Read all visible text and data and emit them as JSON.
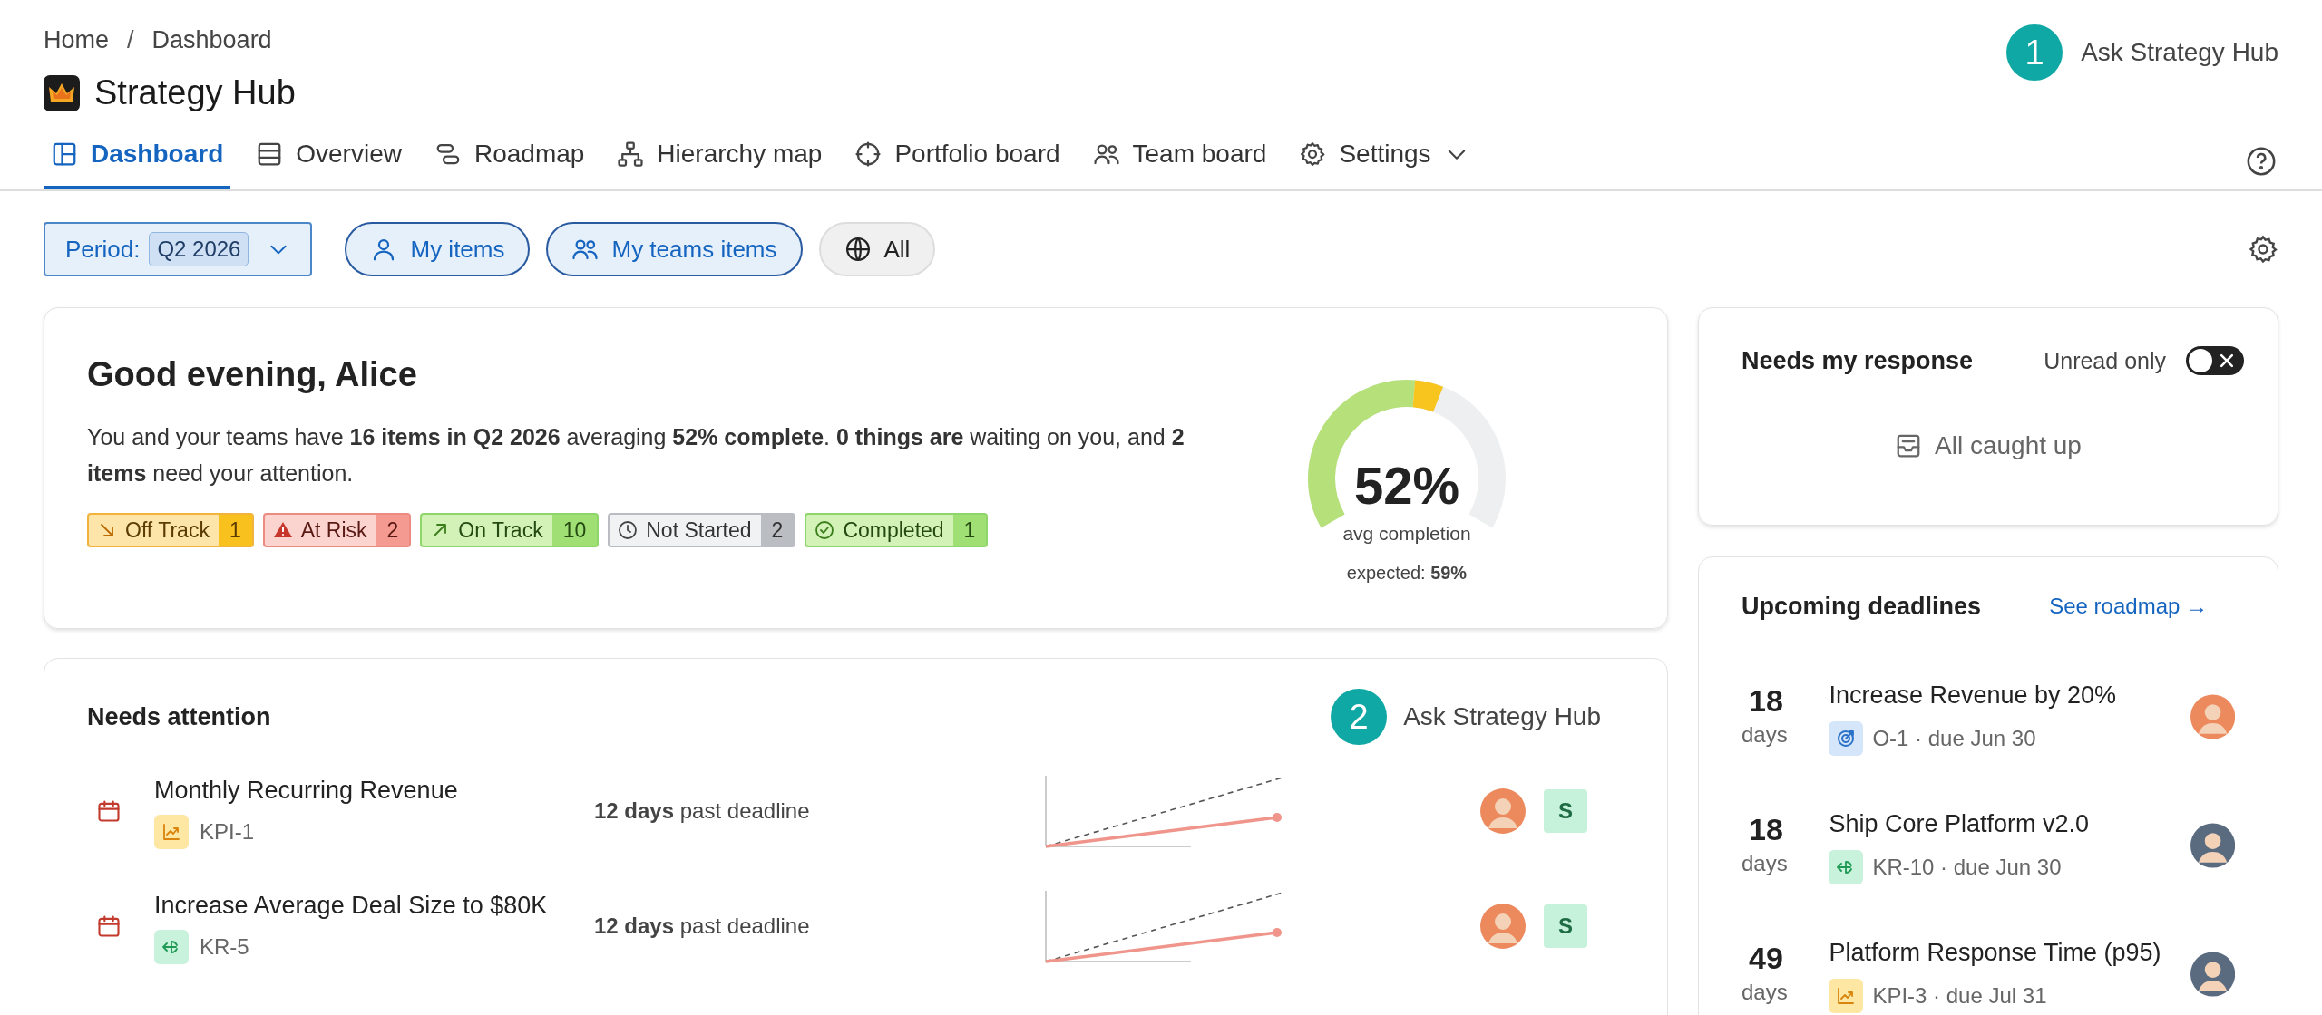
{
  "breadcrumb": [
    {
      "label": "Home"
    },
    {
      "label": "Dashboard"
    }
  ],
  "breadcrumb_separator": "/",
  "app": {
    "title": "Strategy Hub"
  },
  "assistant_button": {
    "badge": "1",
    "label": "Ask Strategy Hub"
  },
  "tabs": [
    {
      "kind": "dashboard",
      "label": "Dashboard",
      "selected": true,
      "dropdown": false
    },
    {
      "kind": "overview",
      "label": "Overview",
      "selected": false,
      "dropdown": false
    },
    {
      "kind": "roadmap",
      "label": "Roadmap",
      "selected": false,
      "dropdown": false
    },
    {
      "kind": "hierarchy",
      "label": "Hierarchy map",
      "selected": false,
      "dropdown": false
    },
    {
      "kind": "portfolio",
      "label": "Portfolio board",
      "selected": false,
      "dropdown": false
    },
    {
      "kind": "team",
      "label": "Team board",
      "selected": false,
      "dropdown": false
    },
    {
      "kind": "settings",
      "label": "Settings",
      "selected": false,
      "dropdown": true
    }
  ],
  "filters": {
    "period": {
      "label": "Period:",
      "value": "Q2 2026"
    },
    "scopes": [
      {
        "kind": "person",
        "label": "My items",
        "selected": true
      },
      {
        "kind": "team",
        "label": "My teams items",
        "selected": true
      },
      {
        "kind": "globe",
        "label": "All",
        "selected": false
      }
    ]
  },
  "summary_card": {
    "title": "Good evening, Alice",
    "text": "You and your teams have **16 items in Q2 2026** averaging **52% complete**. **0 things are** waiting on you, and **2 items** need your attention.",
    "status_chips": [
      {
        "kind": "off_track",
        "label": "Off Track",
        "count": "1"
      },
      {
        "kind": "at_risk",
        "label": "At Risk",
        "count": "2"
      },
      {
        "kind": "on_track",
        "label": "On Track",
        "count": "10"
      },
      {
        "kind": "not_started",
        "label": "Not Started",
        "count": "2"
      },
      {
        "kind": "completed",
        "label": "Completed",
        "count": "1"
      }
    ],
    "gauge": {
      "value": "52%",
      "caption": "avg completion",
      "expected": "expected: **59%**",
      "segments": [
        {
          "kind": "actual",
          "level": 0.52
        },
        {
          "kind": "expected",
          "level": 0.59
        }
      ]
    }
  },
  "needs_attention": {
    "title": "Needs attention",
    "assistant": {
      "badge": "2",
      "label": "Ask Strategy Hub"
    },
    "rows": [
      {
        "title": "Monthly Recurring Revenue",
        "kind": "kpi",
        "tag": "KPI-1",
        "status": "**12 days** past deadline",
        "assignee": "S",
        "color": "#ec8a5e"
      },
      {
        "title": "Increase Average Deal Size to $80K",
        "kind": "kr",
        "tag": "KR-5",
        "status": "**12 days** past deadline",
        "assignee": "S",
        "color": "#ec8a5e"
      }
    ]
  },
  "response_card": {
    "title": "Needs my response",
    "toggle": {
      "label": "Unread only",
      "on": false
    },
    "empty": "All caught up"
  },
  "deadlines_card": {
    "title": "Upcoming deadlines",
    "link": "See roadmap →",
    "rows": [
      {
        "days": "18",
        "unit": "days",
        "title": "Increase Revenue by 20%",
        "kind": "objective",
        "meta": "O-1 · due Jun 30",
        "color": "#ec8a5e"
      },
      {
        "days": "18",
        "unit": "days",
        "title": "Ship Core Platform v2.0",
        "kind": "kr",
        "meta": "KR-10 · due Jun 30",
        "color": "#5a6b80"
      },
      {
        "days": "49",
        "unit": "days",
        "title": "Platform Response Time (p95)",
        "kind": "kpi",
        "meta": "KPI-3 · due Jul 31",
        "color": "#5a6b80"
      }
    ]
  }
}
